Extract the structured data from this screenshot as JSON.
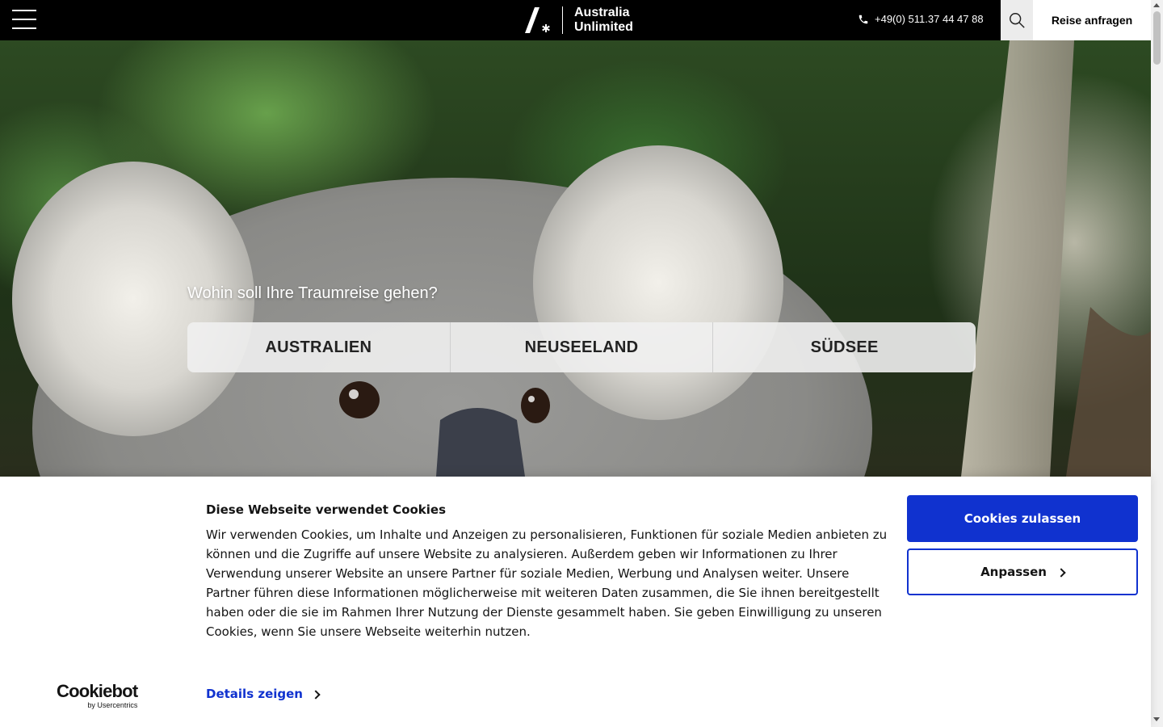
{
  "header": {
    "logo_line1": "Australia",
    "logo_line2": "Unlimited",
    "phone": "+49(0) 511.37 44 47 88",
    "request_label": "Reise anfragen"
  },
  "hero": {
    "title": "Wohin soll Ihre Traumreise gehen?",
    "destinations": [
      {
        "label": "AUSTRALIEN"
      },
      {
        "label": "NEUSEELAND"
      },
      {
        "label": "SÜDSEE"
      }
    ]
  },
  "cookie_banner": {
    "title": "Diese Webseite verwendet Cookies",
    "text": "Wir verwenden Cookies, um Inhalte und Anzeigen zu personalisieren, Funktionen für soziale Medien anbieten zu können und die Zugriffe auf unsere Website zu analysieren. Außerdem geben wir Informationen zu Ihrer Verwendung unserer Website an unsere Partner für soziale Medien, Werbung und Analysen weiter. Unsere Partner führen diese Informationen möglicherweise mit weiteren Daten zusammen, die Sie ihnen bereitgestellt haben oder die sie im Rahmen Ihrer Nutzung der Dienste gesammelt haben. Sie geben Einwilligung zu unseren Cookies, wenn Sie unsere Webseite weiterhin nutzen.",
    "details_label": "Details zeigen",
    "allow_label": "Cookies zulassen",
    "customize_label": "Anpassen",
    "provider_name": "Cookiebot",
    "provider_sub": "by Usercentrics"
  },
  "colors": {
    "header_bg": "#000000",
    "accent_blue": "#1032cf"
  }
}
